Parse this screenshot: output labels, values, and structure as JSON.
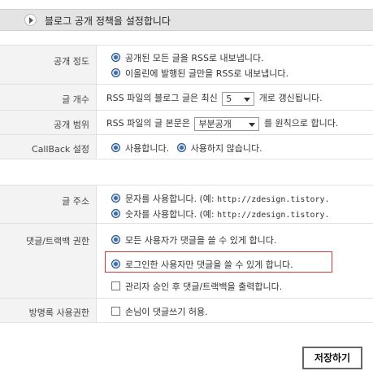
{
  "header": {
    "title": "블로그 공개 정책을 설정합니다"
  },
  "settings": {
    "scope": {
      "label": "공개 정도",
      "option1": "공개된 모든 글을 RSS로 내보냅니다.",
      "option2": "이올린에 발행된 글만을 RSS로 내보냅니다."
    },
    "count": {
      "label": "글 개수",
      "prefix": "RSS 파일의 블로그 글은 최신",
      "value": "5",
      "suffix": "개로 갱신됩니다."
    },
    "range": {
      "label": "공개 범위",
      "prefix": "RSS 파일의 글 본문은",
      "value": "부분공개",
      "suffix": "를 원칙으로 합니다."
    },
    "callback": {
      "label": "CallBack 설정",
      "option_use": "사용합니다.",
      "option_nouse": "사용하지 않습니다."
    }
  },
  "address": {
    "label": "글 주소",
    "option1_text": "문자를 사용합니다. (예:",
    "option1_example": "http://zdesign.tistory.",
    "option2_text": "숫자를 사용합니다. (예:",
    "option2_example": "http://zdesign.tistory."
  },
  "comments": {
    "label": "댓글/트랙백 권한",
    "option_all": "모든 사용자가 댓글을 쓸 수 있게 합니다.",
    "option_login": "로그인한 사용자만 댓글을 쓸 수 있게 합니다.",
    "option_approval": "관리자 승인 후 댓글/트랙백을 출력합니다."
  },
  "guestbook": {
    "label": "방명록 사용권한",
    "option_guest": "손님이 댓글쓰기 허용."
  },
  "save_label": "저장하기",
  "colors": {
    "header_bg": "#e4e4e4",
    "label_bg": "#f3f3f3",
    "highlight": "#d23a3a",
    "radio": "#3c6ea5"
  }
}
